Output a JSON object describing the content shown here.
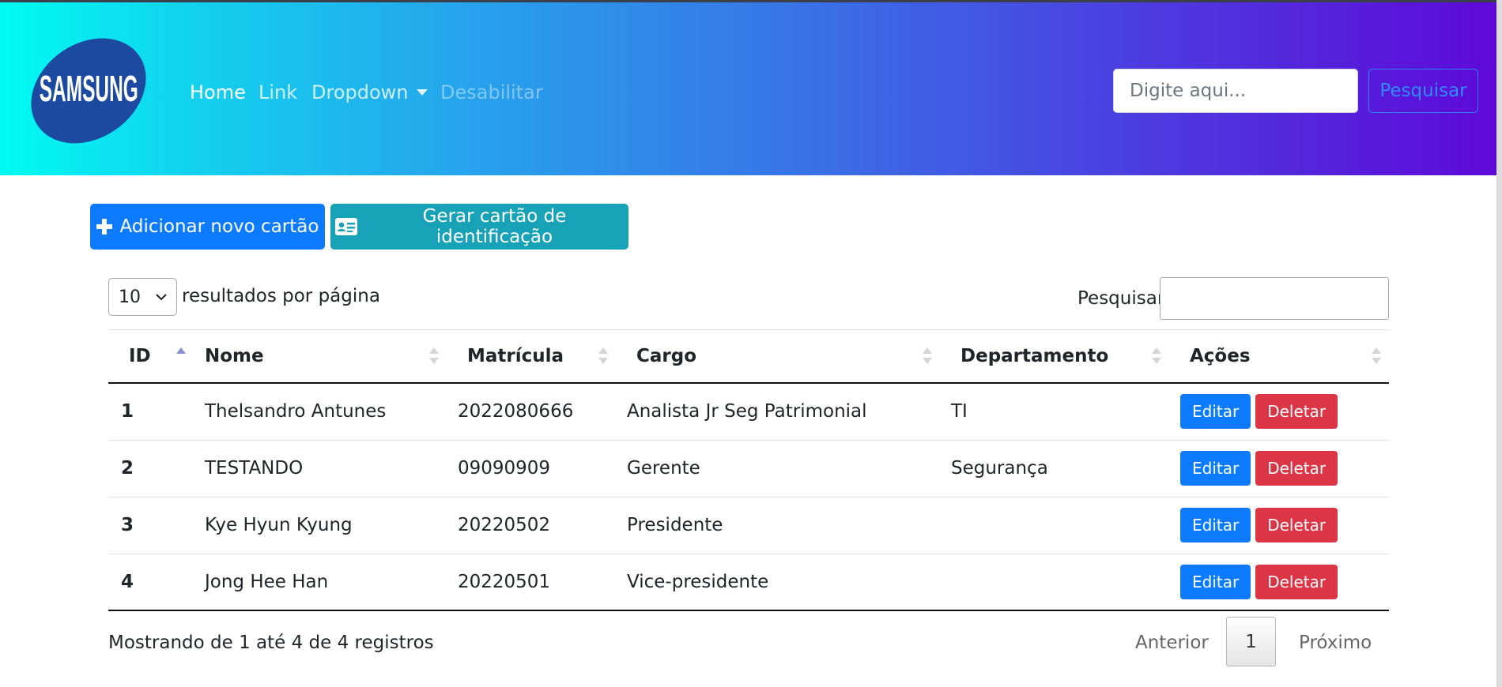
{
  "navbar": {
    "logo_text": "SAMSUNG",
    "links": [
      {
        "label": "Home",
        "state": "active"
      },
      {
        "label": "Link",
        "state": "normal"
      },
      {
        "label": "Dropdown",
        "state": "dropdown"
      },
      {
        "label": "Desabilitar",
        "state": "disabled"
      }
    ],
    "search_placeholder": "Digite aqui...",
    "search_button": "Pesquisar"
  },
  "actions": {
    "add_card": "Adicionar novo cartão",
    "generate_card": "Gerar cartão de identificação"
  },
  "table_controls": {
    "page_length": "10",
    "page_length_label": "resultados por página",
    "search_label": "Pesquisar",
    "search_value": ""
  },
  "table": {
    "columns": [
      "ID",
      "Nome",
      "Matrícula",
      "Cargo",
      "Departamento",
      "Ações"
    ],
    "rows": [
      {
        "id": "1",
        "nome": "Thelsandro Antunes",
        "matricula": "2022080666",
        "cargo": "Analista Jr Seg Patrimonial",
        "departamento": "TI"
      },
      {
        "id": "2",
        "nome": "TESTANDO",
        "matricula": "09090909",
        "cargo": "Gerente",
        "departamento": "Segurança"
      },
      {
        "id": "3",
        "nome": "Kye Hyun Kyung",
        "matricula": "20220502",
        "cargo": "Presidente",
        "departamento": ""
      },
      {
        "id": "4",
        "nome": "Jong Hee Han",
        "matricula": "20220501",
        "cargo": "Vice-presidente",
        "departamento": ""
      }
    ],
    "edit_label": "Editar",
    "delete_label": "Deletar"
  },
  "footer": {
    "info": "Mostrando de 1 até 4 de 4 registros",
    "prev": "Anterior",
    "page": "1",
    "next": "Próximo"
  },
  "colors": {
    "primary": "#0d7bff",
    "info": "#17a2b8",
    "danger": "#dc3545",
    "logo_blue": "#1c4aa0"
  }
}
